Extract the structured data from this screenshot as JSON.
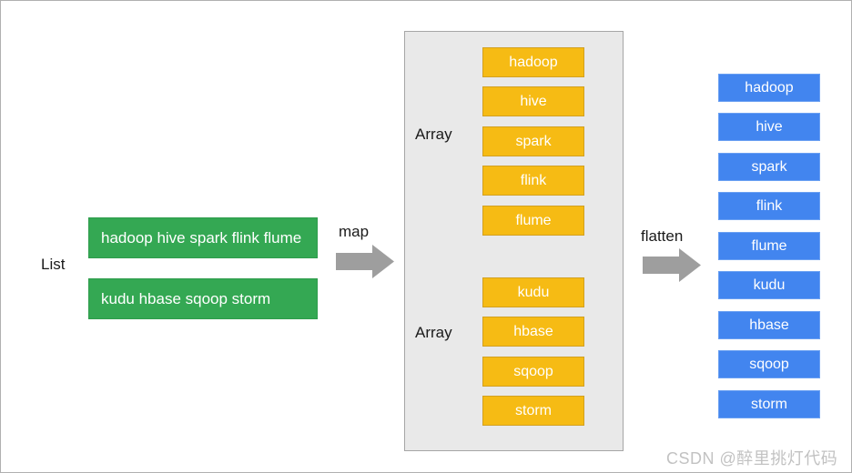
{
  "diagram": {
    "title": "map and flatten transformation diagram",
    "colors": {
      "green": "#34a853",
      "orange": "#f6bb14",
      "blue": "#4285ef",
      "panel_gray": "#e9e9e9",
      "arrow_gray": "#9e9e9e",
      "watermark_gray": "#c2c2c2"
    }
  },
  "source": {
    "label": "List",
    "rows": [
      {
        "text": "hadoop hive spark flink flume"
      },
      {
        "text": "kudu hbase sqoop storm"
      }
    ]
  },
  "arrows": [
    {
      "label": "map",
      "name": "map-arrow"
    },
    {
      "label": "flatten",
      "name": "flatten-arrow"
    }
  ],
  "middle": {
    "groups": [
      {
        "label": "Array",
        "items": [
          "hadoop",
          "hive",
          "spark",
          "flink",
          "flume"
        ]
      },
      {
        "label": "Array",
        "items": [
          "kudu",
          "hbase",
          "sqoop",
          "storm"
        ]
      }
    ]
  },
  "result": {
    "items": [
      "hadoop",
      "hive",
      "spark",
      "flink",
      "flume",
      "kudu",
      "hbase",
      "sqoop",
      "storm"
    ]
  },
  "watermark": {
    "text": "CSDN @醉里挑灯代码"
  }
}
